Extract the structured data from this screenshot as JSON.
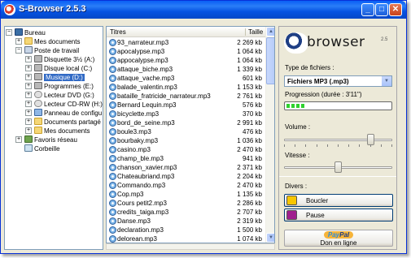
{
  "window": {
    "title": "S-Browser 2.5.3",
    "buttons": {
      "minimize": "_",
      "maximize": "□",
      "close": "✕"
    }
  },
  "tree": {
    "items": [
      {
        "label": "Bureau",
        "icon": "desktop-icon",
        "expander": "−"
      },
      {
        "label": "Mes documents",
        "icon": "folder-icon",
        "expander": "+"
      },
      {
        "label": "Poste de travail",
        "icon": "computer-icon",
        "expander": "−"
      },
      {
        "label": "Disquette 3½ (A:)",
        "icon": "floppy-icon",
        "expander": "+"
      },
      {
        "label": "Disque local (C:)",
        "icon": "drive-icon",
        "expander": "+"
      },
      {
        "label": "Musique (D:)",
        "icon": "drive-icon",
        "expander": "+",
        "selected": true
      },
      {
        "label": "Programmes (E:)",
        "icon": "drive-icon",
        "expander": "+"
      },
      {
        "label": "Lecteur DVD (G:)",
        "icon": "dvd-icon",
        "expander": "+"
      },
      {
        "label": "Lecteur CD-RW (H:)",
        "icon": "cd-icon",
        "expander": "+"
      },
      {
        "label": "Panneau de configu",
        "icon": "control-panel-icon",
        "expander": "+"
      },
      {
        "label": "Documents partagé",
        "icon": "folder-icon",
        "expander": "+"
      },
      {
        "label": "Mes documents",
        "icon": "folder-icon",
        "expander": "+"
      },
      {
        "label": "Favoris réseau",
        "icon": "network-icon",
        "expander": "+"
      },
      {
        "label": "Corbeille",
        "icon": "recycle-bin-icon",
        "expander": ""
      }
    ]
  },
  "filelist": {
    "columns": {
      "name": "Titres",
      "size": "Taille"
    },
    "rows": [
      {
        "name": "93_narrateur.mp3",
        "size": "2 269 kb"
      },
      {
        "name": "apocalypse.mp3",
        "size": "1 064 kb"
      },
      {
        "name": "appocalypse.mp3",
        "size": "1 064 kb"
      },
      {
        "name": "attaque_biche.mp3",
        "size": "1 339 kb"
      },
      {
        "name": "attaque_vache.mp3",
        "size": "601 kb"
      },
      {
        "name": "balade_valentin.mp3",
        "size": "1 153 kb"
      },
      {
        "name": "bataille_fratricide_narrateur.mp3",
        "size": "2 761 kb"
      },
      {
        "name": "Bernard Lequin.mp3",
        "size": "576 kb"
      },
      {
        "name": "bicyclette.mp3",
        "size": "370 kb"
      },
      {
        "name": "bord_de_seine.mp3",
        "size": "2 991 kb"
      },
      {
        "name": "boule3.mp3",
        "size": "476 kb"
      },
      {
        "name": "bourbaky.mp3",
        "size": "1 036 kb"
      },
      {
        "name": "casino.mp3",
        "size": "2 470 kb"
      },
      {
        "name": "champ_ble.mp3",
        "size": "941 kb"
      },
      {
        "name": "chanson_xavier.mp3",
        "size": "2 371 kb"
      },
      {
        "name": "Chateaubriand.mp3",
        "size": "2 204 kb"
      },
      {
        "name": "Commando.mp3",
        "size": "2 470 kb"
      },
      {
        "name": "Cop.mp3",
        "size": "1 135 kb"
      },
      {
        "name": "Cours petit2.mp3",
        "size": "2 286 kb"
      },
      {
        "name": "credits_taiga.mp3",
        "size": "2 707 kb"
      },
      {
        "name": "Danse.mp3",
        "size": "2 319 kb"
      },
      {
        "name": "declaration.mp3",
        "size": "1 500 kb"
      },
      {
        "name": "delorean.mp3",
        "size": "1 074 kb"
      }
    ]
  },
  "panel": {
    "logo": {
      "text": "browser",
      "version": "2.5"
    },
    "file_type_label": "Type de fichiers :",
    "file_type_value": "Fichiers MP3 (.mp3)",
    "progress_label": "Progression (durée : 3'11\")",
    "progress_fraction": 0.2,
    "volume_label": "Volume :",
    "volume_level": 0.82,
    "speed_label": "Vitesse :",
    "speed_level": 0.5,
    "divers_label": "Divers :",
    "loop_button": "Boucler",
    "pause_button": "Pause",
    "paypal_logo_a": "Pay",
    "paypal_logo_b": "Pal",
    "paypal_sub": "Don en ligne"
  },
  "colors": {
    "titlebar": "#0A5FF5",
    "selection": "#316AC5",
    "progress": "#2ED12E",
    "panel_bg": "#ECE9D8"
  }
}
